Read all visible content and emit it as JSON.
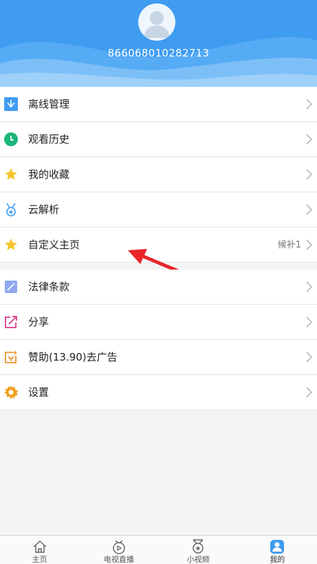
{
  "profile": {
    "user_id": "866068010282713"
  },
  "menu_group1": [
    {
      "label": "离线管理",
      "icon": "offline-download-icon",
      "extra": ""
    },
    {
      "label": "观看历史",
      "icon": "clock-icon",
      "extra": ""
    },
    {
      "label": "我的收藏",
      "icon": "star-icon",
      "extra": ""
    },
    {
      "label": "云解析",
      "icon": "medal-icon",
      "extra": ""
    },
    {
      "label": "自定义主页",
      "icon": "star-icon",
      "extra": "候补1"
    }
  ],
  "menu_group2": [
    {
      "label": "法律条款",
      "icon": "document-icon"
    },
    {
      "label": "分享",
      "icon": "share-icon"
    },
    {
      "label": "赞助(13.90)去广告",
      "icon": "sponsor-icon"
    },
    {
      "label": "设置",
      "icon": "gear-icon"
    }
  ],
  "tabbar": [
    {
      "label": "主页",
      "icon": "home-icon",
      "active": false
    },
    {
      "label": "电视直播",
      "icon": "tv-live-icon",
      "active": false
    },
    {
      "label": "小视频",
      "icon": "short-video-icon",
      "active": false
    },
    {
      "label": "我的",
      "icon": "profile-icon",
      "active": true
    }
  ],
  "colors": {
    "header_blue": "#3f9cf1",
    "accent_green": "#1ab67a",
    "star_yellow": "#f6c52b",
    "annotation_red": "#e8262a"
  }
}
